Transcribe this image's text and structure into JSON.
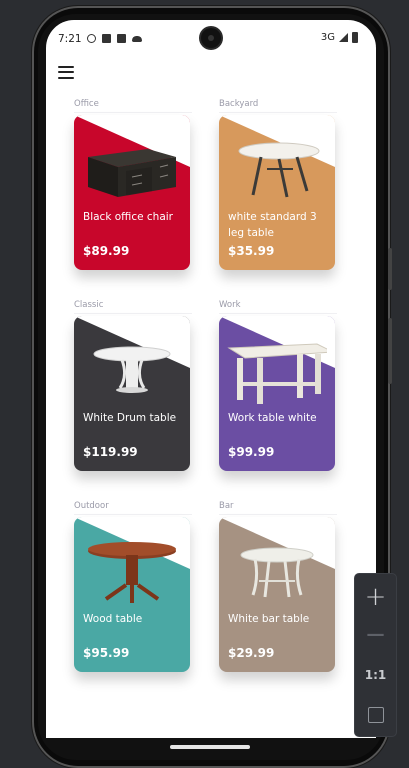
{
  "status_bar": {
    "time": "7:21",
    "network": "3G",
    "left_icons": [
      "dnd-icon",
      "sim-icon",
      "notification-icon",
      "cloud-icon"
    ]
  },
  "app_bar": {
    "menu_icon": "hamburger-menu-icon"
  },
  "products": [
    {
      "category": "Office",
      "name": "Black office chair",
      "price": "$89.99",
      "color": "#c8062b",
      "image": "black-office-desk"
    },
    {
      "category": "Backyard",
      "name": "white standard 3 leg table",
      "price": "$35.99",
      "color": "#d7995c",
      "image": "white-round-3-leg-table"
    },
    {
      "category": "Classic",
      "name": "White Drum table",
      "price": "$119.99",
      "color": "#3a393d",
      "image": "white-drum-table"
    },
    {
      "category": "Work",
      "name": "Work table white",
      "price": "$99.99",
      "color": "#6b4ea3",
      "image": "white-work-table"
    },
    {
      "category": "Outdoor",
      "name": "Wood table",
      "price": "$95.99",
      "color": "#4aa8a4",
      "image": "wood-pedestal-table"
    },
    {
      "category": "Bar",
      "name": "White bar table",
      "price": "$29.99",
      "color": "#a69282",
      "image": "white-bar-table"
    }
  ],
  "zoom_panel": {
    "plus": "+",
    "minus": "−",
    "ratio": "1:1",
    "fit_icon": "fit-screen-icon"
  }
}
